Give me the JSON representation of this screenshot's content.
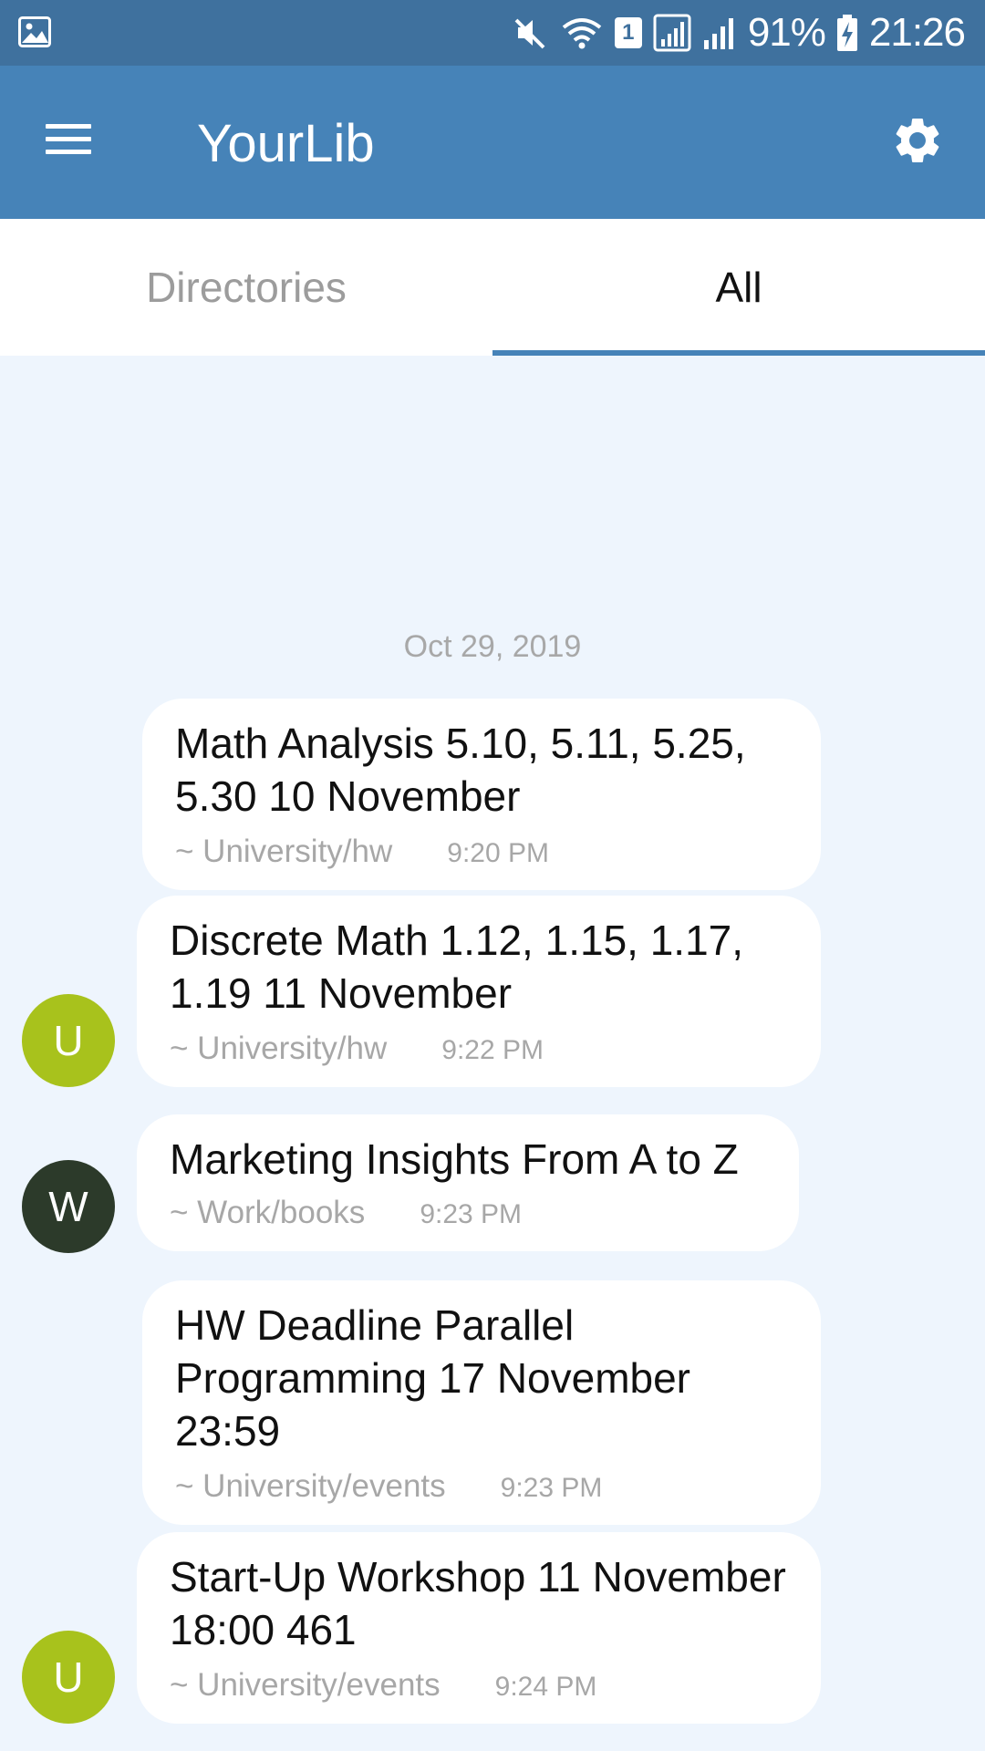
{
  "status_bar": {
    "battery": "91%",
    "time": "21:26",
    "sim_slot": "1",
    "icons": [
      "gallery-icon",
      "mute-icon",
      "wifi-icon",
      "sim-icon",
      "signal-icon",
      "signal-icon",
      "battery-charging-icon"
    ]
  },
  "app_bar": {
    "title": "YourLib",
    "menu_icon": "menu-icon",
    "settings_icon": "gear-icon"
  },
  "tabs": [
    {
      "label": "Directories",
      "selected": false
    },
    {
      "label": "All",
      "selected": true
    }
  ],
  "date_separator": "Oct 29, 2019",
  "messages": [
    {
      "text": "Math Analysis 5.10, 5.11, 5.25, 5.30 10 November",
      "directory": "~ University/hw",
      "time": "9:20 PM"
    },
    {
      "text": "Discrete Math 1.12, 1.15, 1.17, 1.19 11 November",
      "directory": "~ University/hw",
      "time": "9:22 PM",
      "avatar": "U"
    },
    {
      "text": "Marketing Insights From A to Z",
      "directory": "~ Work/books",
      "time": "9:23 PM",
      "avatar": "W"
    },
    {
      "text": "HW Deadline Parallel Programming 17 November 23:59",
      "directory": "~ University/events",
      "time": "9:23 PM"
    },
    {
      "text": "Start-Up Workshop 11 November 18:00 461",
      "directory": "~ University/events",
      "time": "9:24 PM",
      "avatar": "U"
    }
  ],
  "colors": {
    "app_bar": "#4683b8",
    "status_bar": "#3f719e",
    "background": "#eef5fd",
    "avatar_university": "#a8c21c",
    "avatar_work": "#2c3a2a"
  }
}
